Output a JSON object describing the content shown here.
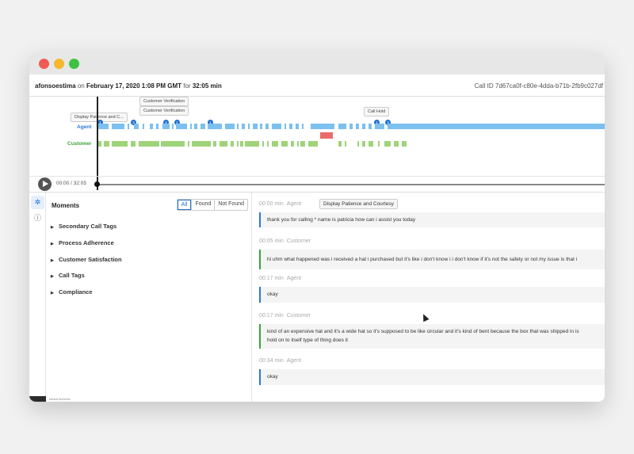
{
  "header": {
    "user": "afonsoestima",
    "on_text": "on",
    "date": "February 17, 2020 1:08 PM GMT",
    "for_text": "for",
    "duration": "32:05 min",
    "call_id": "Call ID 7d67ca0f-c80e-4dda-b71b-2fb9c027df"
  },
  "timeline": {
    "tags": [
      "Display Patience and C...",
      "Customer Verification",
      "Customer Verification",
      "Call Hold"
    ],
    "pins": [
      "1",
      "2",
      "2",
      "1",
      "1",
      "1",
      "2"
    ],
    "agent_label": "Agent",
    "customer_label": "Customer"
  },
  "player": {
    "time": "00:00 / 32:05"
  },
  "moments": {
    "title": "Moments",
    "filters": [
      "All",
      "Found",
      "Not Found"
    ],
    "categories": [
      "Secondary Call Tags",
      "Process Adherence",
      "Customer Satisfaction",
      "Call Tags",
      "Compliance"
    ],
    "footer": "Neutral Moments"
  },
  "transcript": [
    {
      "time": "00:00 min",
      "speaker": "Agent",
      "tag": "Display Patience and Courtesy",
      "text": "thank you for calling * name is patricia how can i assist you today"
    },
    {
      "time": "00:05 min",
      "speaker": "Customer",
      "text": "hi uhm what happened was i received a hat i purchased but it's like i don't know i i don't know if it's not the safety or not my issue is that i"
    },
    {
      "time": "00:17 min",
      "speaker": "Agent",
      "text": "okay"
    },
    {
      "time": "00:17 min",
      "speaker": "Customer",
      "text": "kind of an expensive hat and it's a wide hat so it's supposed to be like circular and it's kind of bent because the box that was shipped in is",
      "text2": "hold on to itself type of thing does it"
    },
    {
      "time": "00:34 min",
      "speaker": "Agent",
      "text": "okay"
    }
  ]
}
